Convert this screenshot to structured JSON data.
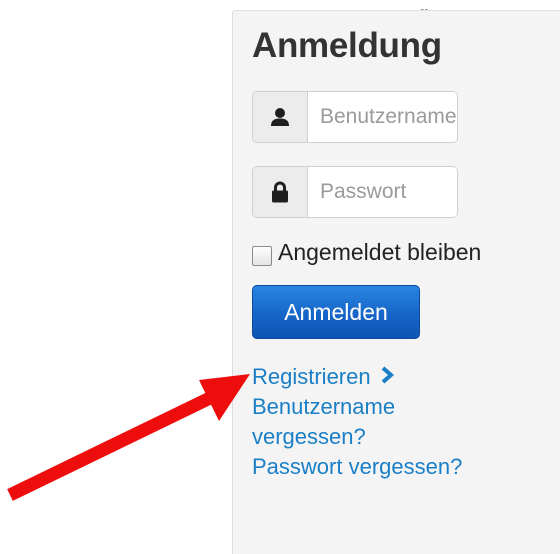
{
  "top_fragment": "„",
  "login": {
    "title": "Anmeldung",
    "username_placeholder": "Benutzername",
    "password_placeholder": "Passwort",
    "remember_label": "Angemeldet bleiben",
    "submit_label": "Anmelden",
    "links": {
      "register": "Registrieren",
      "forgot_username_line1": "Benutzername",
      "forgot_username_line2": "vergessen?",
      "forgot_password": "Passwort vergessen?"
    }
  },
  "annotation": {
    "arrow_color": "#ee0d0d",
    "icons": [
      "user-icon",
      "lock-icon",
      "chevron-right-icon",
      "red-arrow"
    ]
  }
}
